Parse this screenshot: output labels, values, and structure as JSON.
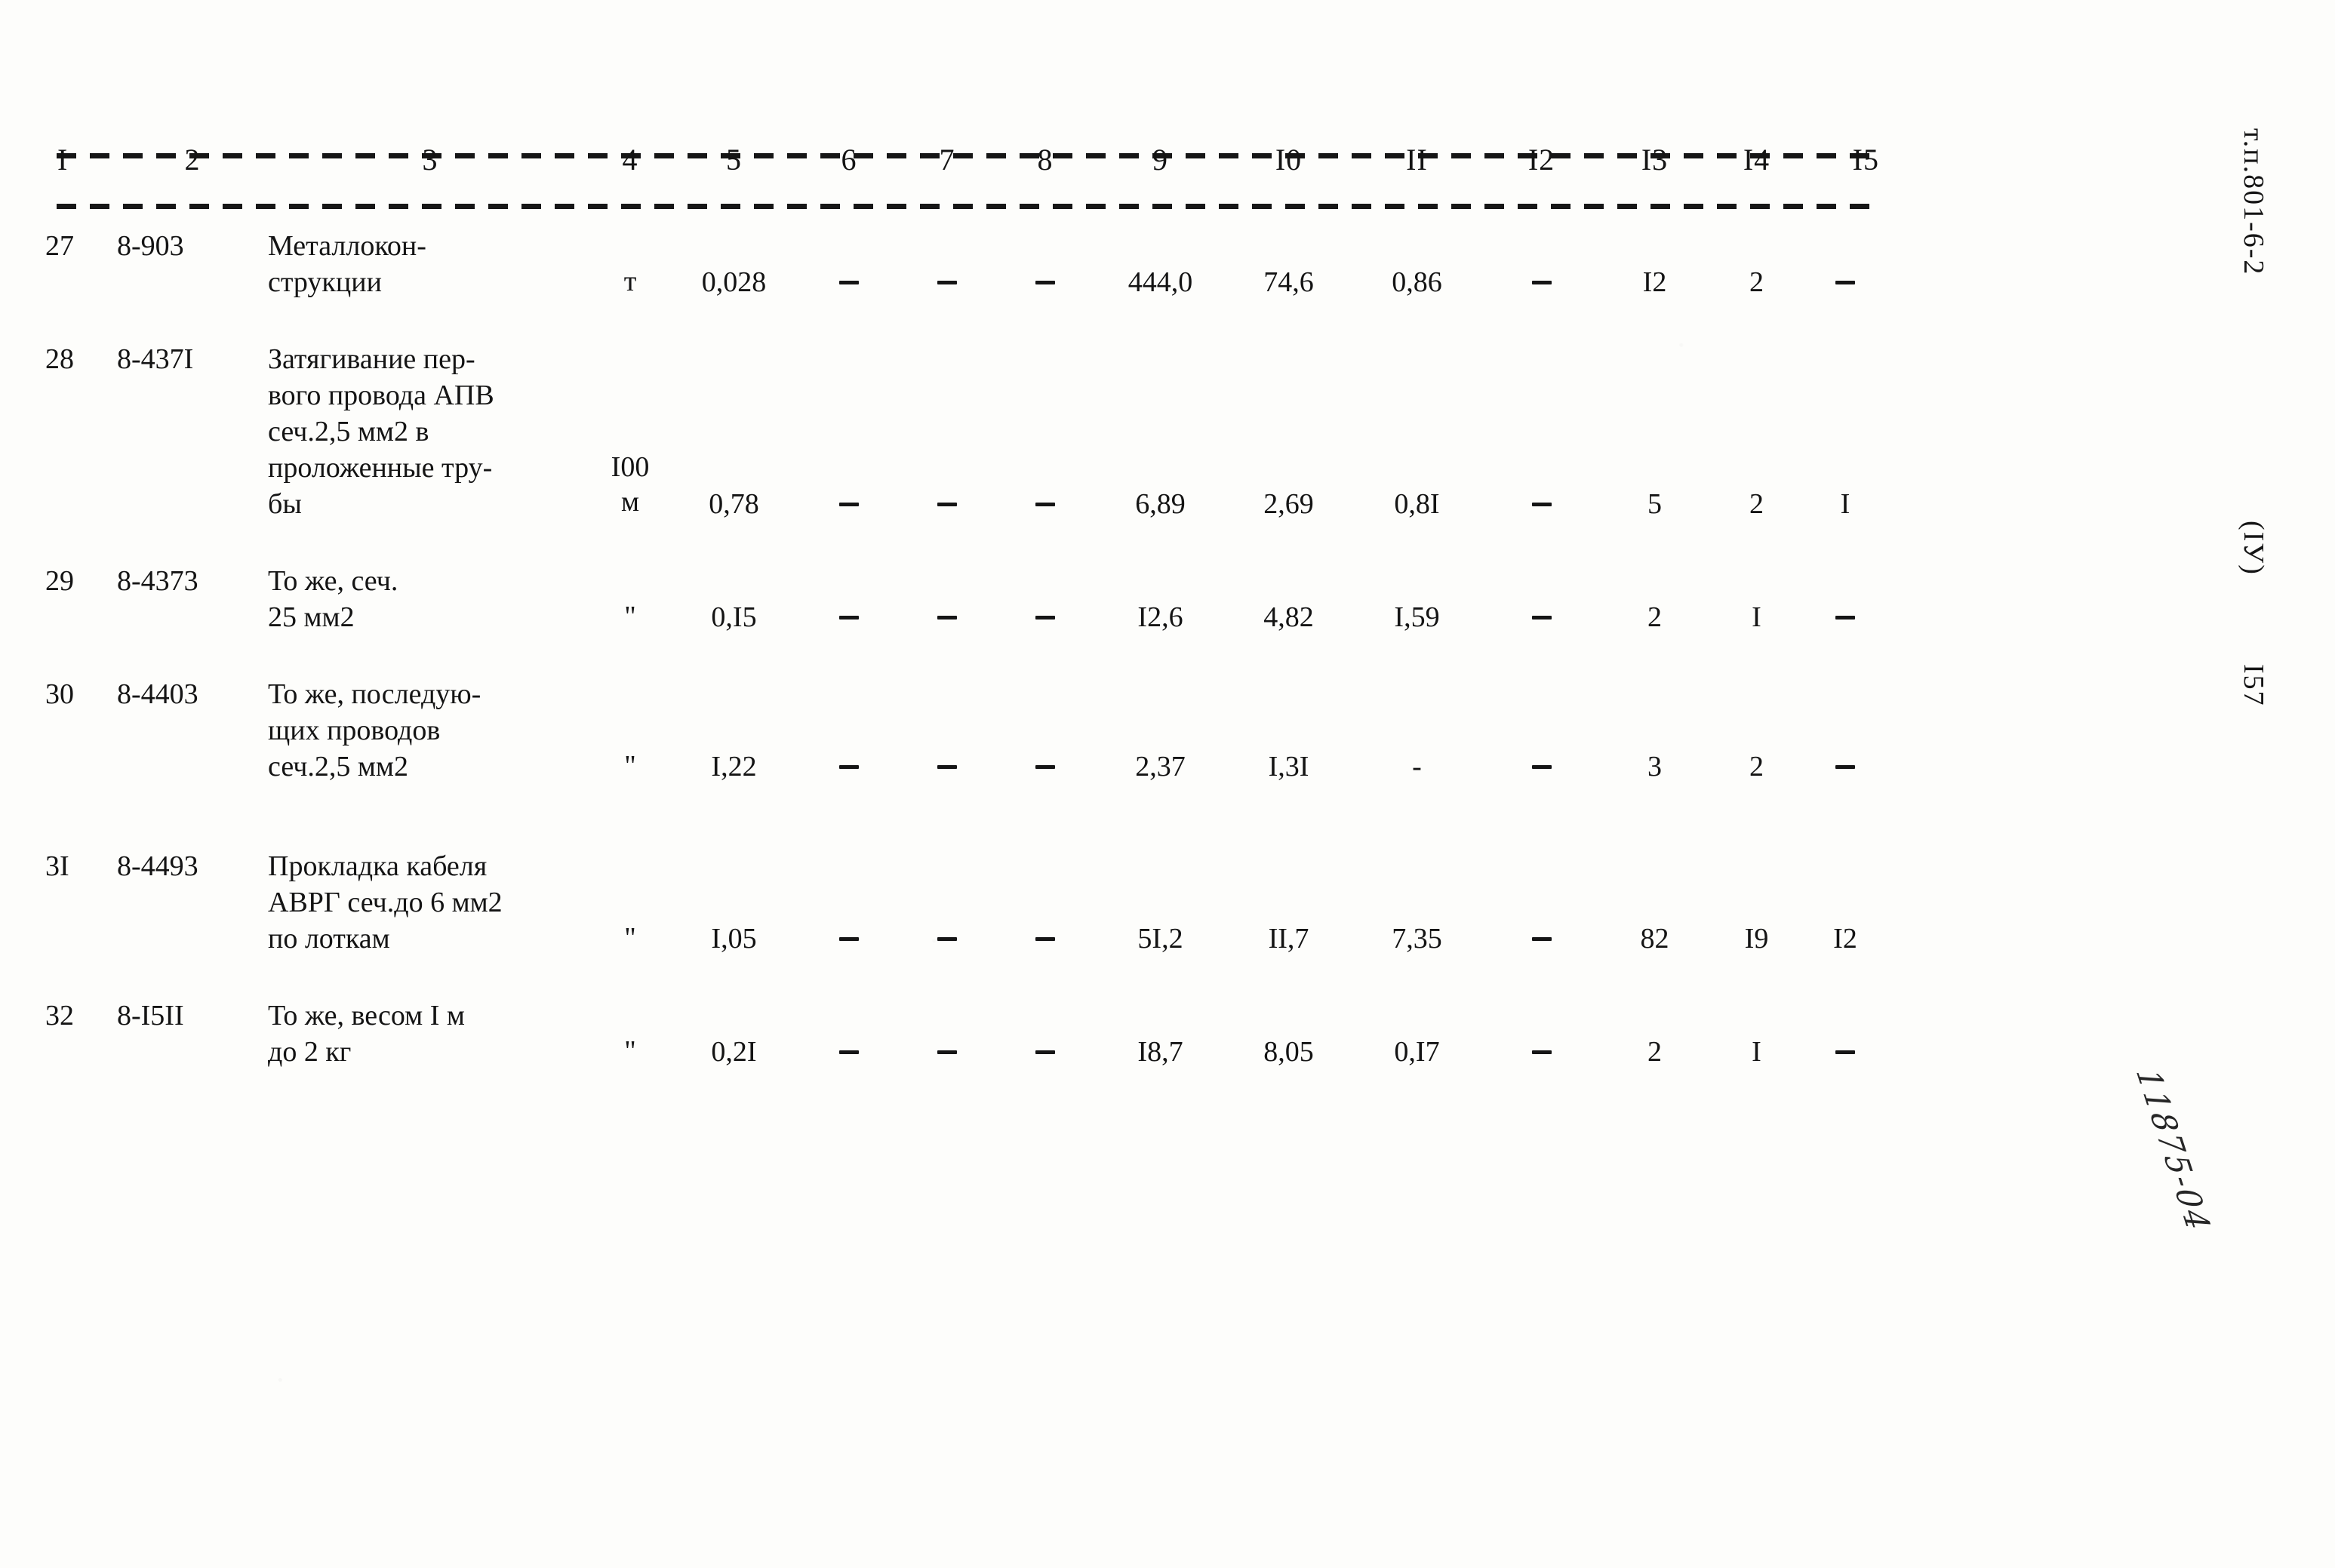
{
  "document": {
    "type": "scanned-estimate-table",
    "margin_notes": {
      "series_code": "т.п.801-6-2",
      "section_roman": "(IУ)",
      "page_number": "I57",
      "handwritten": "11875-04"
    }
  },
  "table": {
    "column_headers": [
      "I",
      "2",
      "3",
      "4",
      "5",
      "6",
      "7",
      "8",
      "9",
      "I0",
      "II",
      "I2",
      "I3",
      "I4",
      "I5"
    ],
    "empty_mark": "-",
    "rows": [
      {
        "num": "27",
        "code": "8-903",
        "description_lines": [
          "Металлокон-",
          "струкции"
        ],
        "unit_lines": [
          "т"
        ],
        "c5": "0,028",
        "c6": "-",
        "c7": "-",
        "c8": "-",
        "c9": "444,0",
        "c10": "74,6",
        "c11": "0,86",
        "c12": "-",
        "c13": "I2",
        "c14": "2",
        "c15": "-"
      },
      {
        "num": "28",
        "code": "8-437I",
        "description_lines": [
          "Затягивание пер-",
          "вого провода АПВ",
          "сеч.2,5 мм2 в",
          "проложенные тру-",
          "бы"
        ],
        "unit_lines": [
          "I00",
          "м"
        ],
        "c5": "0,78",
        "c6": "-",
        "c7": "-",
        "c8": "-",
        "c9": "6,89",
        "c10": "2,69",
        "c11": "0,8I",
        "c12": "-",
        "c13": "5",
        "c14": "2",
        "c15": "I"
      },
      {
        "num": "29",
        "code": "8-4373",
        "description_lines": [
          "То же, сеч.",
          "25 мм2"
        ],
        "unit_lines": [
          "\""
        ],
        "c5": "0,I5",
        "c6": "-",
        "c7": "-",
        "c8": "-",
        "c9": "I2,6",
        "c10": "4,82",
        "c11": "I,59",
        "c12": "-",
        "c13": "2",
        "c14": "I",
        "c15": "-"
      },
      {
        "num": "30",
        "code": "8-4403",
        "description_lines": [
          "То же, последую-",
          "щих проводов",
          "сеч.2,5 мм2"
        ],
        "unit_lines": [
          "\""
        ],
        "c5": "I,22",
        "c6": "-",
        "c7": "-",
        "c8": "-",
        "c9": "2,37",
        "c10": "I,3I",
        "c11": "-",
        "c12": "-",
        "c13": "3",
        "c14": "2",
        "c15": "-"
      },
      {
        "num": "3I",
        "code": "8-4493",
        "description_lines": [
          "Прокладка кабеля",
          "АВРГ сеч.до 6 мм2",
          "по лоткам"
        ],
        "unit_lines": [
          "\""
        ],
        "c5": "I,05",
        "c6": "-",
        "c7": "-",
        "c8": "-",
        "c9": "5I,2",
        "c10": "II,7",
        "c11": "7,35",
        "c12": "-",
        "c13": "82",
        "c14": "I9",
        "c15": "I2"
      },
      {
        "num": "32",
        "code": "8-I5II",
        "description_lines": [
          "То же, весом I м",
          "до 2 кг"
        ],
        "unit_lines": [
          "\""
        ],
        "c5": "0,2I",
        "c6": "-",
        "c7": "-",
        "c8": "-",
        "c9": "I8,7",
        "c10": "8,05",
        "c11": "0,I7",
        "c12": "-",
        "c13": "2",
        "c14": "I",
        "c15": "-"
      }
    ]
  }
}
